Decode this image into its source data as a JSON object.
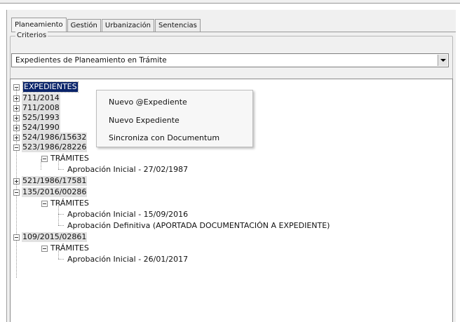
{
  "tabs": [
    "Planeamiento",
    "Gestión",
    "Urbanización",
    "Sentencias"
  ],
  "active_tab": "Planeamiento",
  "criterios": {
    "legend": "Criterios",
    "selected": "Expedientes de Planeamiento en Trámite"
  },
  "tree": {
    "root": "EXPEDIENTES",
    "items": [
      {
        "label": "711/2014",
        "expanded": false
      },
      {
        "label": "711/2008",
        "expanded": false
      },
      {
        "label": "525/1993",
        "expanded": false
      },
      {
        "label": "524/1990",
        "expanded": false
      },
      {
        "label": "524/1986/15632",
        "expanded": false
      },
      {
        "label": "523/1986/28226",
        "expanded": true,
        "tramites_label": "TRÁMITES",
        "tramites": [
          "Aprobación Inicial - 27/02/1987"
        ]
      },
      {
        "label": "521/1986/17581",
        "expanded": false
      },
      {
        "label": "135/2016/00286",
        "expanded": true,
        "tramites_label": "TRÁMITES",
        "tramites": [
          "Aprobación Inicial - 15/09/2016",
          "Aprobación Definitiva (APORTADA DOCUMENTACIÓN A EXPEDIENTE)"
        ]
      },
      {
        "label": "109/2015/02861",
        "expanded": true,
        "tramites_label": "TRÁMITES",
        "tramites": [
          "Aprobación Inicial - 26/01/2017"
        ]
      }
    ]
  },
  "context_menu": {
    "items": [
      "Nuevo @Expediente",
      "Nuevo Expediente",
      "Sincroniza con Documentum"
    ]
  }
}
